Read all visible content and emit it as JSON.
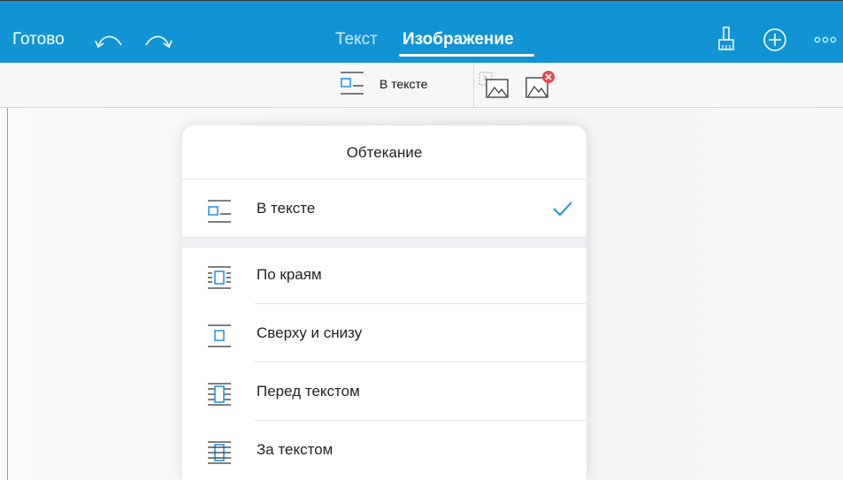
{
  "toolbar": {
    "done_label": "Готово",
    "tabs": [
      {
        "label": "Текст",
        "active": false
      },
      {
        "label": "Изображение",
        "active": true
      }
    ],
    "accent_color": "#1294d4"
  },
  "subbar": {
    "wrap_label": "В тексте"
  },
  "popover": {
    "title": "Обтекание",
    "selected": "В тексте",
    "options": [
      {
        "label": "В тексте",
        "icon": "wrap-inline-icon",
        "checked": true
      },
      {
        "label": "По краям",
        "icon": "wrap-around-icon",
        "checked": false
      },
      {
        "label": "Сверху и снизу",
        "icon": "wrap-top-bottom-icon",
        "checked": false
      },
      {
        "label": "Перед текстом",
        "icon": "wrap-in-front-icon",
        "checked": false
      },
      {
        "label": "За текстом",
        "icon": "wrap-behind-icon",
        "checked": false
      }
    ],
    "check_color": "#1a8fe3"
  }
}
